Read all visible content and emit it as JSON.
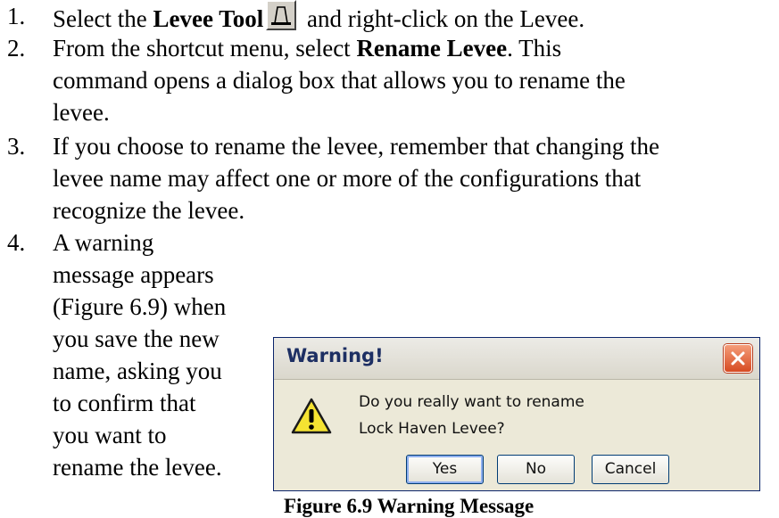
{
  "steps": [
    {
      "num": "1.",
      "pre": "Select the ",
      "bold": "Levee Tool",
      "post": " and right-click on the Levee.",
      "icon": "levee-tool-icon"
    },
    {
      "num": "2.",
      "line1_pre": "From the shortcut menu, select ",
      "line1_bold": "Rename Levee",
      "line1_post": ".  This",
      "line2": "command opens a dialog box that allows you to rename the",
      "line3": "levee."
    },
    {
      "num": "3.",
      "line1": "If you choose to rename the levee, remember that changing the",
      "line2": "levee name may affect one or more of the configurations that",
      "line3": "recognize the levee."
    },
    {
      "num": "4.",
      "lines": [
        "A warning",
        "message appears",
        "(Figure 6.9) when",
        "you save the new",
        "name, asking you",
        "to confirm that",
        "you want to",
        "rename the levee."
      ]
    }
  ],
  "dialog": {
    "title": "Warning!",
    "message_line1": "Do you really want to rename",
    "message_line2": "Lock Haven Levee?",
    "buttons": {
      "yes": "Yes",
      "no": "No",
      "cancel": "Cancel"
    },
    "icon": "warning-icon",
    "close_icon": "close-icon"
  },
  "caption": "Figure 6.9  Warning Message",
  "colors": {
    "dialog_bg": "#ece9d8",
    "title_text": "#1d2f63",
    "close_red": "#d74a22",
    "warning_yellow": "#f5e332"
  }
}
